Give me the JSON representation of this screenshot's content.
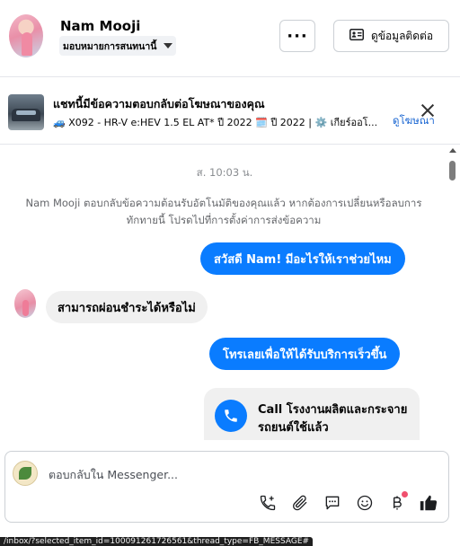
{
  "header": {
    "contact_name": "Nam Mooji",
    "assign_label": "มอบหมายการสนทนานี้",
    "more_label": "···",
    "contact_info_label": "ดูข้อมูลติดต่อ"
  },
  "ad_banner": {
    "title": "แชทนี้มีข้อความตอบกลับต่อโฆษณาของคุณ",
    "subtitle": "🚙 X092 - HR-V e:HEV 1.5 EL AT* ปี 2022 🗓️ ปี 2022 | ⚙️ เกียร์ออโ...",
    "view_ad_link": "ดูโฆษณา"
  },
  "chat": {
    "timestamp": "ส. 10:03 น.",
    "notice": "Nam Mooji ตอบกลับข้อความต้อนรับอัตโนมัติของคุณแล้ว หากต้องการเปลี่ยนหรือลบการทักทายนี้ โปรดไปที่การตั้งค่าการส่งข้อความ",
    "messages": [
      {
        "from": "page",
        "text": "สวัสดี Nam! มีอะไรให้เราช่วยไหม"
      },
      {
        "from": "user",
        "text": "สามารถผ่อนชำระได้หรือไม่"
      },
      {
        "from": "page",
        "text": "โทรเลยเพื่อให้ได้รับบริการเร็วขึ้น"
      }
    ],
    "call_card": {
      "text": "Call โรงงานผลิตและกระจายรถยนต์ใช้แล้ว"
    }
  },
  "composer": {
    "placeholder": "ตอบกลับใน Messenger...",
    "tools": [
      "phone-add-icon",
      "paperclip-icon",
      "saved-reply-icon",
      "emoji-icon",
      "baht-payment-icon",
      "thumbs-up-icon"
    ]
  },
  "status_bar": {
    "url_text": "/inbox/?selected_item_id=100091261726561&thread_type=FB_MESSAGE#"
  },
  "colors": {
    "accent_blue": "#0a7cff",
    "link_blue": "#1a66d2",
    "bubble_gray": "#f0f0f0",
    "notif_dot": "#f0506e"
  }
}
